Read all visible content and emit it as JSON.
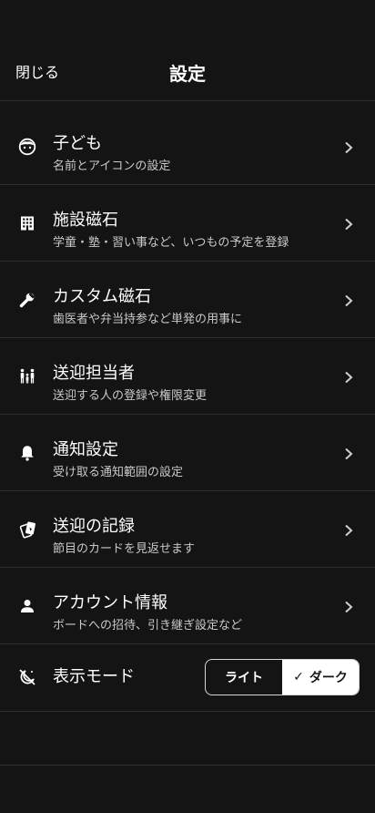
{
  "header": {
    "close_label": "閉じる",
    "title": "設定"
  },
  "items": [
    {
      "label": "子ども",
      "sub": "名前とアイコンの設定",
      "icon": "child-face-icon"
    },
    {
      "label": "施設磁石",
      "sub": "学童・塾・習い事など、いつもの予定を登録",
      "icon": "building-icon"
    },
    {
      "label": "カスタム磁石",
      "sub": "歯医者や弁当持参など単発の用事に",
      "icon": "wrench-icon"
    },
    {
      "label": "送迎担当者",
      "sub": "送迎する人の登録や権限変更",
      "icon": "family-icon"
    },
    {
      "label": "通知設定",
      "sub": "受け取る通知範囲の設定",
      "icon": "bell-icon"
    },
    {
      "label": "送迎の記録",
      "sub": "節目のカードを見返せます",
      "icon": "cards-icon"
    },
    {
      "label": "アカウント情報",
      "sub": "ボードへの招待、引き継ぎ設定など",
      "icon": "person-icon"
    }
  ],
  "display_mode": {
    "label": "表示モード",
    "icon": "theme-icon",
    "options": {
      "light": "ライト",
      "dark": "ダーク"
    },
    "selected": "dark",
    "check": "✓"
  }
}
